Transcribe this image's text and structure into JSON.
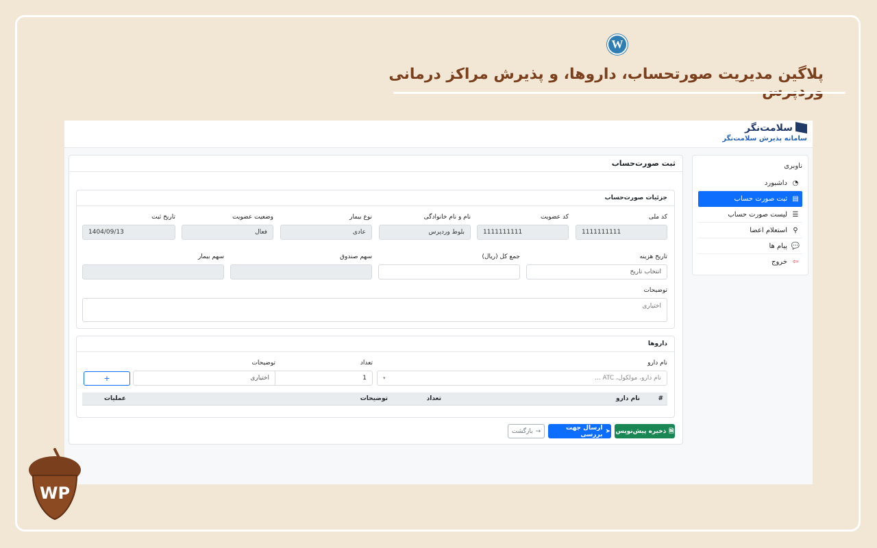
{
  "promo": {
    "title": "پلاگین مدیریت صورتحساب، داروها، و پذیرش مراکز درمانی وردپرس",
    "wp_logo": "W",
    "badge_text": "WP"
  },
  "brand": {
    "name": "سلامت‌نگر",
    "subtitle": "سامانه پذیرش سلامت‌نگر"
  },
  "sidebar": {
    "title": "ناوبری",
    "items": [
      {
        "label": "داشبورد",
        "icon": "dashboard-icon",
        "glyph": "◔"
      },
      {
        "label": "ثبت صورت حساب",
        "icon": "file-icon",
        "glyph": "▤",
        "active": true
      },
      {
        "label": "لیست صورت حساب",
        "icon": "list-icon",
        "glyph": "☰"
      },
      {
        "label": "استعلام اعضا",
        "icon": "search-icon",
        "glyph": "⚲"
      },
      {
        "label": "پیام ها",
        "icon": "chat-icon",
        "glyph": "💬"
      },
      {
        "label": "خروج",
        "icon": "logout-icon",
        "glyph": "⇦"
      }
    ]
  },
  "main": {
    "title": "ثبت صورت‌حساب",
    "details": {
      "title": "جزئیات صورت‌حساب",
      "national_code": {
        "label": "کد ملی",
        "value": "1111111111"
      },
      "member_code": {
        "label": "کد عضویت",
        "value": "1111111111"
      },
      "full_name": {
        "label": "نام و نام خانوادگی",
        "value": "بلوط وردپرس"
      },
      "patient_type": {
        "label": "نوع بیمار",
        "value": "عادی"
      },
      "membership_status": {
        "label": "وضعیت عضویت",
        "value": "فعال"
      },
      "register_date": {
        "label": "تاریخ ثبت",
        "value": "1404/09/13"
      },
      "expense_date": {
        "label": "تاریخ هزینه",
        "placeholder": "انتخاب تاریخ"
      },
      "total": {
        "label": "جمع کل (ریال)",
        "value": ""
      },
      "fund_share": {
        "label": "سهم صندوق",
        "value": ""
      },
      "patient_share": {
        "label": "سهم بیمار",
        "value": ""
      },
      "notes": {
        "label": "توضیحات",
        "placeholder": "اختیاری"
      }
    },
    "drugs": {
      "title": "داروها",
      "drug_name": {
        "label": "نام دارو",
        "placeholder": "نام دارو، مولکول، ATC ..."
      },
      "count": {
        "label": "تعداد",
        "value": "1"
      },
      "notes": {
        "label": "توضیحات",
        "placeholder": "اختیاری"
      },
      "add_label": "+",
      "table_columns": [
        "#",
        "نام دارو",
        "تعداد",
        "توضیحات",
        "عملیات"
      ]
    },
    "buttons": {
      "save_draft": "ذخیره پیش‌نویس",
      "send_review": "ارسال جهت بررسی",
      "back": "بازگشت"
    }
  }
}
